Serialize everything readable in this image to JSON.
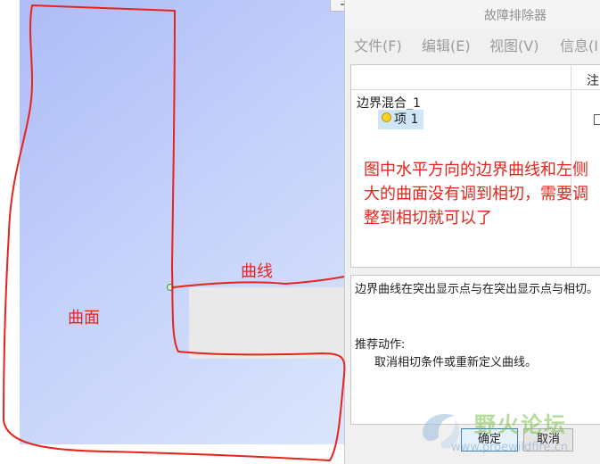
{
  "dialog": {
    "title": "故障排除器",
    "menu": [
      {
        "label": "文件(F)"
      },
      {
        "label": "编辑(E)"
      },
      {
        "label": "视图(V)"
      },
      {
        "label": "信息(I"
      }
    ],
    "tree": {
      "column_note": "注",
      "root": "边界混合_1",
      "child": "项 1"
    },
    "description": "边界曲线在突出显示点与在突出显示点与相切。",
    "recommended_title": "推荐动作:",
    "recommended_action": "取消相切条件或重新定义曲线。",
    "buttons": {
      "ok": "确定",
      "cancel": "取消"
    }
  },
  "annotations": {
    "main_note": "图中水平方向的边界曲线和左侧大的曲面没有调到相切，需要调整到相切就可以了",
    "curve_label": "曲线",
    "surface_label": "曲面"
  },
  "watermark": {
    "title": "野火论坛",
    "url": "www.proewildfire.cn"
  },
  "colors": {
    "annotation_red": "#e8231c",
    "surface_blue": "#b9c6f9",
    "selection_highlight": "#cfe6f7"
  }
}
